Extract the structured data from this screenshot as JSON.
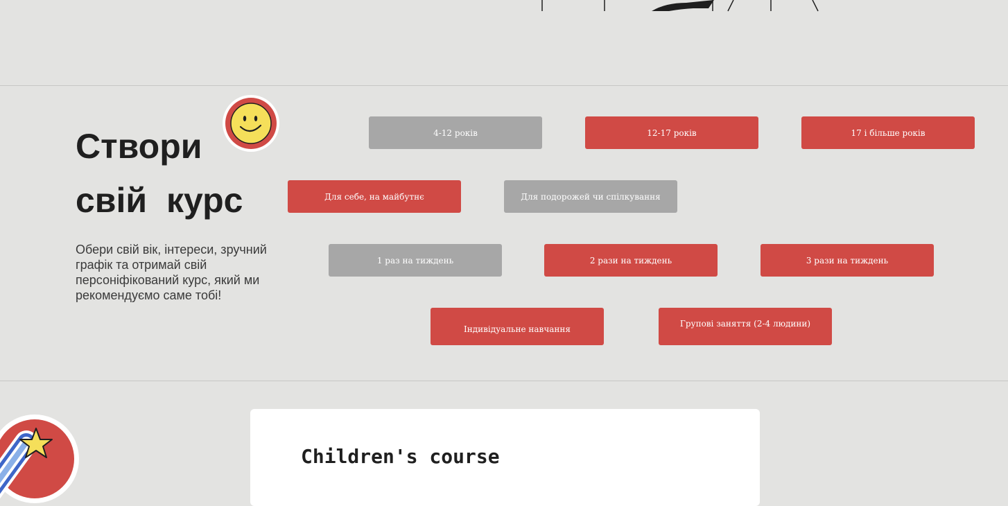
{
  "heading": {
    "line1": "Створи",
    "line2": "свій  курс"
  },
  "description": "Обери свій вік, інтереси, зручний графік та отримай свій персоніфікований курс, який ми рекомендуємо саме тобі!",
  "options": {
    "age": [
      {
        "label": "4-12 років",
        "selected": false
      },
      {
        "label": "12-17 років",
        "selected": true
      },
      {
        "label": "17 і більше років",
        "selected": true
      }
    ],
    "goal": [
      {
        "label": "Для себе, на майбутнє",
        "selected": true
      },
      {
        "label": "Для подорожей чи спілкування",
        "selected": false
      }
    ],
    "frequency": [
      {
        "label": "1 раз на тиждень",
        "selected": false
      },
      {
        "label": "2 рази на тиждень",
        "selected": true
      },
      {
        "label": "3 рази на тиждень",
        "selected": true
      }
    ],
    "format": [
      {
        "label": "Індивідуальне навчання",
        "selected": true
      },
      {
        "label": "Групові заняття (2-4 людини)",
        "selected": true
      }
    ]
  },
  "course_card": {
    "title": "Children's course"
  },
  "colors": {
    "background": "#e3e3e1",
    "selected": "#d04a45",
    "unselected": "#a7a7a7",
    "text": "#1f1f1f"
  },
  "icons": {
    "smiley": "smiley-face-icon",
    "star": "shooting-star-icon"
  }
}
